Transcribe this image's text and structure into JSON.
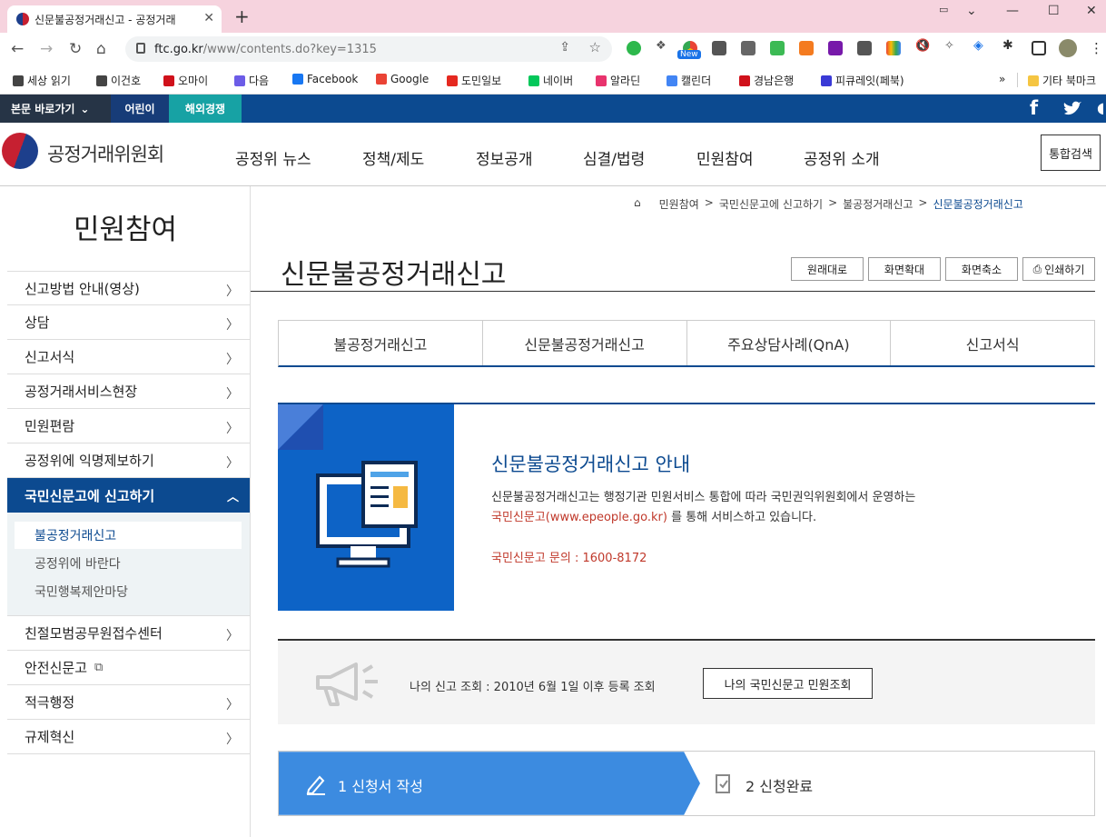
{
  "browser": {
    "tab_title": "신문불공정거래신고 - 공정거래",
    "url_host": "ftc.go.kr",
    "url_path": "/www/contents.do?key=1315",
    "ext_new_badge": "New",
    "bookmarks": [
      {
        "label": "세상 읽기",
        "icon": "dots-icon",
        "color": "#444444"
      },
      {
        "label": "이건호",
        "icon": "dots-icon",
        "color": "#444444"
      },
      {
        "label": "오마이",
        "icon": "ohmy-icon",
        "color": "#d0111b"
      },
      {
        "label": "다음",
        "icon": "daum-icon",
        "color": "#6c5ce7"
      },
      {
        "label": "Facebook",
        "icon": "facebook-icon",
        "color": "#1877f2"
      },
      {
        "label": "Google",
        "icon": "google-icon",
        "color": "#ea4335"
      },
      {
        "label": "도민일보",
        "icon": "info-icon",
        "color": "#e52920"
      },
      {
        "label": "네이버",
        "icon": "naver-icon",
        "color": "#03c75a"
      },
      {
        "label": "알라딘",
        "icon": "aladin-icon",
        "color": "#e8336d"
      },
      {
        "label": "캘린더",
        "icon": "calendar-icon",
        "color": "#4285f4"
      },
      {
        "label": "경남은행",
        "icon": "bank-icon",
        "color": "#d0111b"
      },
      {
        "label": "피큐레잇(페북)",
        "icon": "pq-icon",
        "color": "#3a3ad6"
      }
    ],
    "other_bookmarks": "기타 북마크"
  },
  "site": {
    "skip_label": "본문 바로가기",
    "kids_label": "어린이",
    "competition_label": "해외경쟁",
    "logo_text": "공정거래위원회",
    "gnb": [
      "공정위 뉴스",
      "정책/제도",
      "정보공개",
      "심결/법령",
      "민원참여",
      "공정위 소개"
    ],
    "search_label": "통합검색"
  },
  "sidebar": {
    "title": "민원참여",
    "items": [
      "신고방법 안내(영상)",
      "상담",
      "신고서식",
      "공정거래서비스현장",
      "민원편람",
      "공정위에 익명제보하기"
    ],
    "active": "국민신문고에 신고하기",
    "subitems": [
      "불공정거래신고",
      "공정위에 바란다",
      "국민행복제안마당"
    ],
    "items_after": [
      "친절모범공무원접수센터",
      "안전신문고",
      "적극행정",
      "규제혁신"
    ]
  },
  "content": {
    "breadcrumb": [
      "민원참여",
      "국민신문고에 신고하기",
      "불공정거래신고",
      "신문불공정거래신고"
    ],
    "title": "신문불공정거래신고",
    "tools": [
      "원래대로",
      "화면확대",
      "화면축소",
      "인쇄하기"
    ],
    "tabs": [
      "불공정거래신고",
      "신문불공정거래신고",
      "주요상담사례(QnA)",
      "신고서식"
    ],
    "info_title": "신문불공정거래신고 안내",
    "info_desc1": "신문불공정거래신고는 행정기관 민원서비스 통합에 따라 국민권익위원회에서 운영하는",
    "info_link": "국민신문고(www.epeople.go.kr)",
    "info_desc2": " 를 통해 서비스하고 있습니다.",
    "info_phone": "국민신문고 문의 : 1600-8172",
    "lookup_text": "나의 신고 조회 : 2010년 6월 1일 이후 등록 조회",
    "lookup_button": "나의 국민신문고 민원조회",
    "step1": "1 신청서 작성",
    "step2": "2 신청완료"
  }
}
